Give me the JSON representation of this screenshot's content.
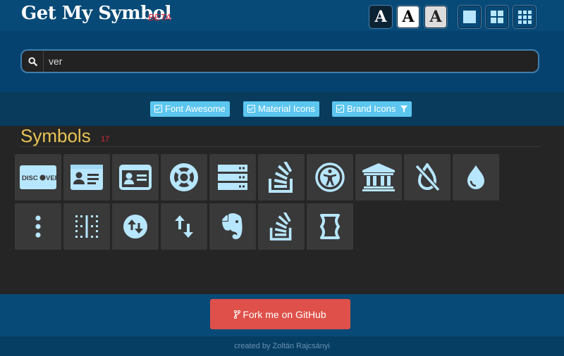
{
  "header": {
    "logo": "Get My Symbol",
    "badge": "BETA",
    "font_buttons": [
      "A",
      "A",
      "A"
    ],
    "layout_buttons": [
      "single-column-icon",
      "two-by-two-grid-icon",
      "three-by-three-grid-icon"
    ]
  },
  "search": {
    "value": "ver",
    "icon": "search-icon"
  },
  "filters": [
    {
      "label": "Font Awesome",
      "checked": true
    },
    {
      "label": "Material Icons",
      "checked": true
    },
    {
      "label": "Brand Icons",
      "checked": true,
      "icon": "filter-icon"
    }
  ],
  "results": {
    "title": "Symbols",
    "count": "17",
    "icons": [
      "discover-card-icon",
      "id-card-icon",
      "id-card-outline-icon",
      "life-ring-icon",
      "server-icon",
      "stack-overflow-icon",
      "universal-access-icon",
      "university-icon",
      "tint-slash-icon",
      "tint-icon",
      "ellipsis-vertical-icon",
      "border-vertical-icon",
      "swap-vertical-circle-icon",
      "swap-vertical-icon",
      "evernote-icon",
      "stack-overflow-icon",
      "hourglass-empty-icon"
    ]
  },
  "footer": {
    "fork_label": "Fork me on GitHub",
    "credit": "created by Zoltán Rajcsányi"
  },
  "colors": {
    "header_bg": "#074a77",
    "accent": "#5cc6ef",
    "icon": "#b7e6ff",
    "title": "#e9c454",
    "badge": "#e0263a",
    "fork": "#de5049"
  }
}
